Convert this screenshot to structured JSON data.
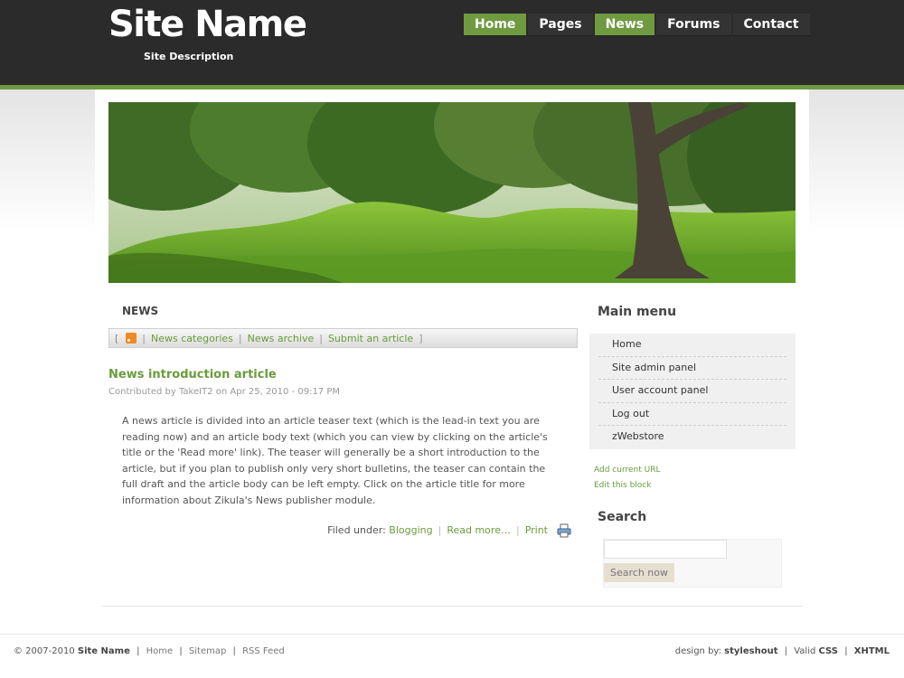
{
  "header": {
    "site_name": "Site Name",
    "site_description": "Site Description",
    "nav": [
      {
        "label": "Home",
        "active": true
      },
      {
        "label": "Pages",
        "active": false
      },
      {
        "label": "News",
        "active": true
      },
      {
        "label": "Forums",
        "active": false
      },
      {
        "label": "Contact",
        "active": false
      }
    ]
  },
  "banner": {
    "icon": "landscape-image"
  },
  "news": {
    "heading": "NEWS",
    "bar": {
      "open_bracket": "[",
      "close_bracket": "]",
      "rss_icon": "rss-icon",
      "links": [
        "News categories",
        "News archive",
        "Submit an article"
      ]
    },
    "article": {
      "title": "News introduction article",
      "meta": "Contributed by TakeIT2 on Apr 25, 2010 - 09:17 PM",
      "body": "A news article is divided into an article teaser text (which is the lead-in text you are reading now) and an article body text (which you can view by clicking on the article's title or the 'Read more' link). The teaser will generally be a short introduction to the article, but if you plan to publish only very short bulletins, the teaser can contain the full draft and the article body can be left empty. Click on the article title for more information about Zikula's News publisher module.",
      "filed_under_label": "Filed under:",
      "category": "Blogging",
      "read_more": "Read more…",
      "print": "Print"
    }
  },
  "sidebar": {
    "main_menu_title": "Main menu",
    "menu_items": [
      "Home",
      "Site admin panel",
      "User account panel",
      "Log out",
      "zWebstore"
    ],
    "add_current_url": "Add current URL",
    "edit_block": "Edit this block",
    "search_title": "Search",
    "search_placeholder": "",
    "search_button": "Search now"
  },
  "footer": {
    "copyright": "© 2007-2010",
    "site_name": "Site Name",
    "links": [
      "Home",
      "Sitemap",
      "RSS Feed"
    ],
    "design_by_label": "design by:",
    "designer": "styleshout",
    "valid_label": "Valid",
    "css": "CSS",
    "xhtml": "XHTML"
  },
  "colors": {
    "accent": "#6f9a3f",
    "header_bg": "#2b2b2b",
    "link": "#6a9b3c"
  }
}
